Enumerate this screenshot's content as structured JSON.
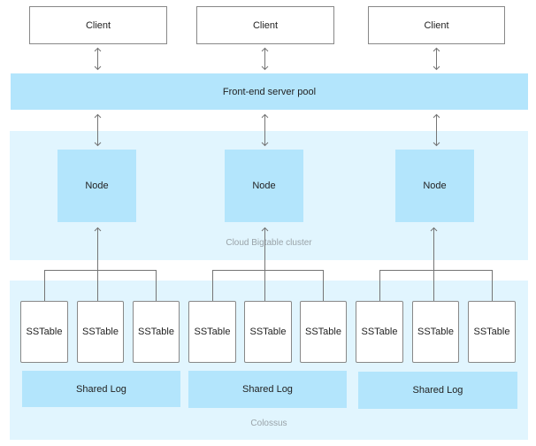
{
  "clients": [
    "Client",
    "Client",
    "Client"
  ],
  "frontend": {
    "label": "Front-end server pool"
  },
  "cluster": {
    "label": "Cloud Bigtable cluster",
    "nodes": [
      "Node",
      "Node",
      "Node"
    ]
  },
  "colossus": {
    "label": "Colossus",
    "sstables": [
      "SSTable",
      "SSTable",
      "SSTable",
      "SSTable",
      "SSTable",
      "SSTable",
      "SSTable",
      "SSTable",
      "SSTable"
    ],
    "shared_logs": [
      "Shared Log",
      "Shared Log",
      "Shared Log"
    ]
  },
  "colors": {
    "light_panel": "#e1f5fe",
    "box_fill": "#b3e5fc",
    "line": "#757575"
  }
}
